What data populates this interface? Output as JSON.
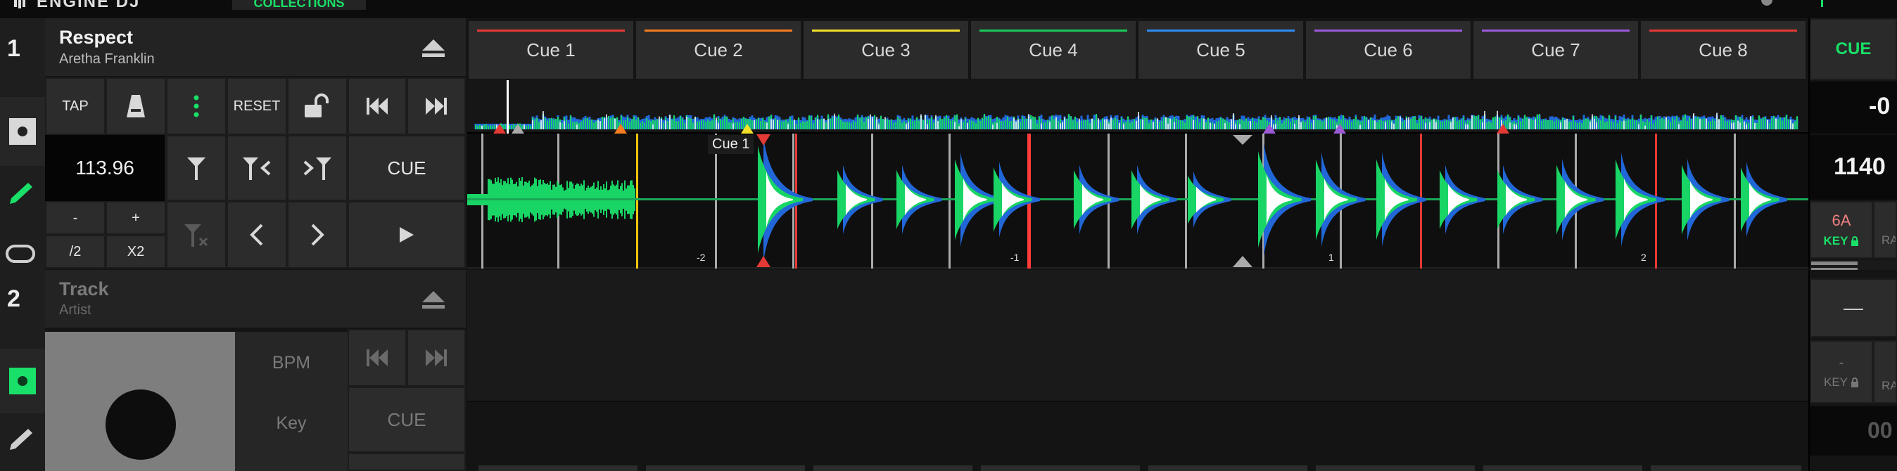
{
  "app": {
    "logo_text": "ENGINE DJ",
    "top_tab": "COLLECTIONS"
  },
  "deck1": {
    "number": "1",
    "title": "Respect",
    "artist": "Aretha Franklin",
    "bpm": "113.96",
    "buttons": {
      "tap": "TAP",
      "reset": "RESET",
      "cue": "CUE",
      "minus": "-",
      "plus": "+",
      "half": "/2",
      "double": "X2"
    },
    "cues": [
      {
        "label": "Cue 1",
        "color": "#e53935"
      },
      {
        "label": "Cue 2",
        "color": "#f57c1f"
      },
      {
        "label": "Cue 3",
        "color": "#f1e02a"
      },
      {
        "label": "Cue 4",
        "color": "#19c95b"
      },
      {
        "label": "Cue 5",
        "color": "#2f8cf0"
      },
      {
        "label": "Cue 6",
        "color": "#9b59d8"
      },
      {
        "label": "Cue 7",
        "color": "#9b59d8"
      },
      {
        "label": "Cue 8",
        "color": "#e53935"
      }
    ],
    "waveform": {
      "cue_marker_label": "Cue 1",
      "beat_labels": [
        "-2",
        "-1",
        "1",
        "2"
      ]
    },
    "right_panel": {
      "cue": "CUE",
      "pitch": "-0",
      "bpm": "1140",
      "key": "6A",
      "key_label": "KEY",
      "range_label": "RA"
    },
    "accent": "#19e068"
  },
  "deck2": {
    "number": "2",
    "title": "Track",
    "artist": "Artist",
    "bpm_label": "BPM",
    "key_label": "Key",
    "cue": "CUE",
    "right_panel": {
      "pitch": "—",
      "key": "-",
      "key_label": "KEY",
      "range_label": "RA",
      "bpm": "00"
    }
  }
}
